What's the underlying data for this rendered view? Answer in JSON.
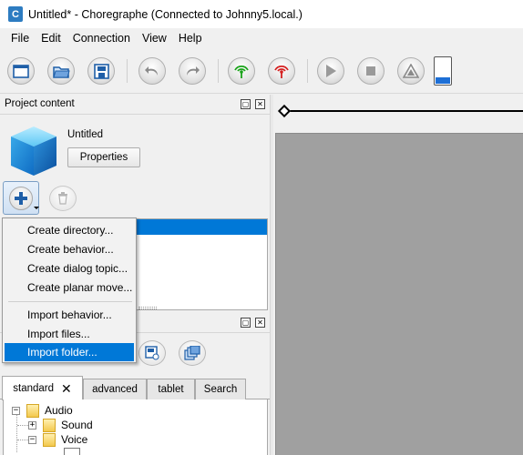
{
  "window": {
    "title": "Untitled* - Choregraphe (Connected to Johnny5.local.)",
    "app_icon_letter": "C"
  },
  "menubar": {
    "items": [
      "File",
      "Edit",
      "Connection",
      "View",
      "Help"
    ]
  },
  "toolbar": {
    "buttons": [
      "new-project-icon",
      "open-project-icon",
      "save-project-icon",
      "undo-icon",
      "redo-icon",
      "connect-icon",
      "disconnect-icon",
      "play-icon",
      "stop-icon",
      "debug-icon"
    ],
    "battery_level": 0.22,
    "colors": {
      "connect": "#1aa31a",
      "disconnect": "#d42020",
      "battery": "#1d6fd6"
    }
  },
  "project_panel": {
    "title": "Project content",
    "project_name": "Untitled",
    "properties_label": "Properties"
  },
  "add_menu": {
    "items": [
      "Create directory...",
      "Create behavior...",
      "Create dialog topic...",
      "Create planar move...",
      "Import behavior...",
      "Import files...",
      "Import folder..."
    ],
    "highlighted_index": 6
  },
  "library_panel": {
    "tabs": [
      "standard",
      "advanced",
      "tablet",
      "Search"
    ],
    "active_tab": "standard",
    "tree": [
      "Audio",
      "Sound",
      "Voice"
    ]
  },
  "colors": {
    "selection": "#0078d7",
    "canvas": "#a0a0a0"
  }
}
